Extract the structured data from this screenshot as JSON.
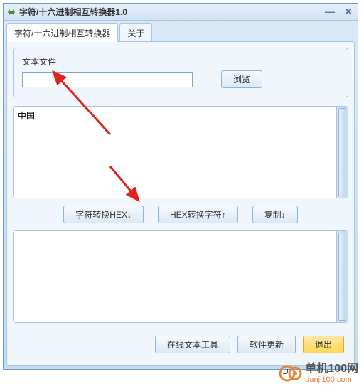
{
  "window": {
    "title": "字符/十六进制相互转换器1.0"
  },
  "tabs": {
    "main": "字符/十六进制相互转换器",
    "about": "关于"
  },
  "file": {
    "label": "文本文件",
    "value": "",
    "browse": "浏览"
  },
  "input_text": "中国",
  "output_text": "",
  "actions": {
    "to_hex": "字符转换HEX↓",
    "to_char": "HEX转换字符↑",
    "copy": "复制↓"
  },
  "footer": {
    "online_tool": "在线文本工具",
    "update": "软件更新",
    "exit": "退出"
  },
  "watermark": {
    "main": "单机100网",
    "sub": "danji100.com"
  }
}
